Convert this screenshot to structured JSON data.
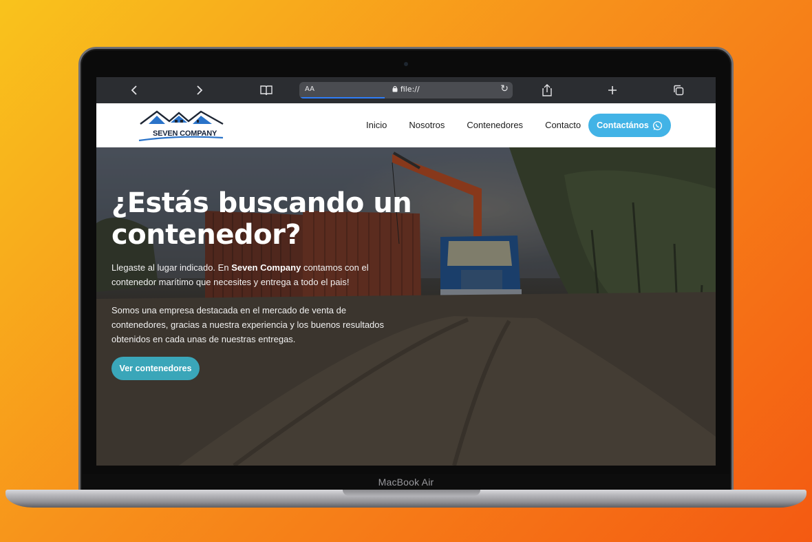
{
  "device": {
    "label": "MacBook Air"
  },
  "browser": {
    "url": "file://",
    "text_size_label": "AA",
    "load_progress": 0.4
  },
  "site": {
    "logo_text": "SEVEN COMPANY",
    "nav": [
      "Inicio",
      "Nosotros",
      "Contenedores",
      "Contacto"
    ],
    "contact_button": "Contactános",
    "colors": {
      "accent": "#42b3e6",
      "cta": "#3aa6b9"
    }
  },
  "hero": {
    "title": "¿Estás buscando un contenedor?",
    "p1_before": "Llegaste al lugar indicado. En ",
    "p1_bold": "Seven Company",
    "p1_after": " contamos con el contenedor marítimo que necesites y entrega a todo el pais!",
    "p2": "Somos una empresa destacada en el mercado de venta de contenedores, gracias a nuestra experiencia y los buenos resultados obtenidos en cada unas de nuestras entregas.",
    "cta": "Ver contenedores"
  }
}
